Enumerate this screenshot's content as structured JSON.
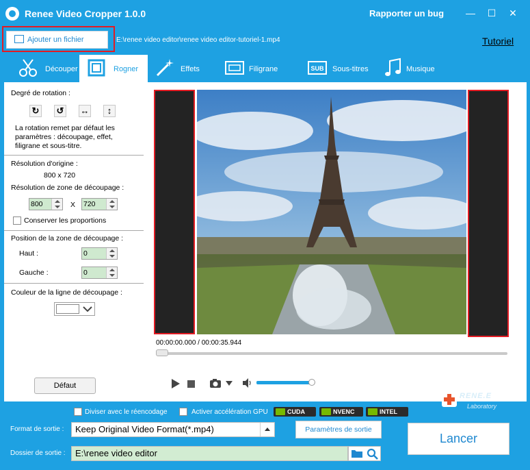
{
  "window": {
    "title": "Renee Video Cropper 1.0.0",
    "report_bug": "Rapporter un bug",
    "min_glyph": "—",
    "max_glyph": "☐",
    "close_glyph": "✕"
  },
  "toolbar": {
    "add_file": "Ajouter un fichier",
    "file_path": "E:\\renee video editor\\renee video editor-tutoriel-1.mp4",
    "tutorial": "Tutoriel"
  },
  "tabs": [
    {
      "label": "Découper",
      "icon": "scissors-icon"
    },
    {
      "label": "Rogner",
      "icon": "crop-icon",
      "active": true
    },
    {
      "label": "Effets",
      "icon": "magic-wand-icon"
    },
    {
      "label": "Filigrane",
      "icon": "watermark-icon"
    },
    {
      "label": "Sous-titres",
      "icon": "subtitle-icon",
      "badge": "SUB"
    },
    {
      "label": "Musique",
      "icon": "music-icon"
    }
  ],
  "left": {
    "rotation_title": "Degré de rotation :",
    "rotation_note": "La rotation remet par défaut les paramètres : découpage, effet, filigrane et sous-titre.",
    "orig_res_label": "Résolution d'origine :",
    "orig_res_value": "800 x 720",
    "crop_res_label": "Résolution de zone de découpage :",
    "width_value": "800",
    "times": "X",
    "height_value": "720",
    "keep_ratio": "Conserver les proportions",
    "position_title": "Position de la zone de découpage :",
    "top_label": "Haut :",
    "top_value": "0",
    "left_label": "Gauche :",
    "left_value": "0",
    "line_color_label": "Couleur de la ligne de découpage :",
    "default_btn": "Défaut"
  },
  "player": {
    "timecode": "00:00:00.000 / 00:00:35.944",
    "volume": 0.95
  },
  "bottom": {
    "split_reencode": "Diviser avec le réencodage",
    "gpu_accel": "Activer accélération GPU",
    "gpu_badges": [
      "CUDA",
      "NVENC",
      "INTEL"
    ],
    "output_format_label": "Format de sortie :",
    "output_format_value": "Keep Original Video Format(*.mp4)",
    "params_btn": "Paramètres de sortie",
    "output_folder_label": "Dossier de sortie :",
    "output_folder_value": "E:\\renee video editor",
    "launch_btn": "Lancer",
    "brand_name": "RENE.E",
    "brand_sub": "Laboratory"
  },
  "colors": {
    "accent": "#1ea1e2",
    "highlight": "#e31b23",
    "gpu_green": "#76b900"
  }
}
